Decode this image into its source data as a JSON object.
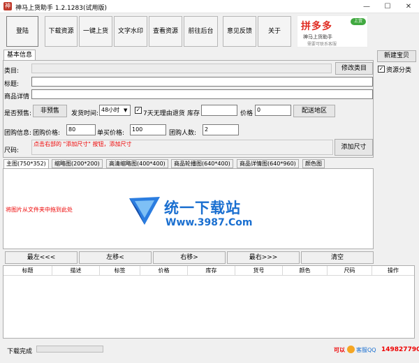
{
  "app": {
    "title": "神马上货助手 1.2.1283(试用版)",
    "icon": "神"
  },
  "window_controls": {
    "minimize": "—",
    "maximize": "☐",
    "close": "✕"
  },
  "toolbar": {
    "buttons": [
      "登陆",
      "下载资源",
      "一键上货",
      "文字水印",
      "查看资源",
      "前往后台",
      "意见反馈",
      "关于"
    ]
  },
  "banner": {
    "brand": "拼多多",
    "badge": "上货",
    "line1": "神马上货助手",
    "line2": "需要可联系客服"
  },
  "right_panel": {
    "new_item": "新建宝贝",
    "resource_category": "资源分类",
    "resource_category_checked": true
  },
  "tab": {
    "basic_info": "基本信息"
  },
  "form": {
    "category_label": "类目:",
    "category_value": "",
    "modify_category": "修改类目",
    "title_label": "标题:",
    "title_value": "",
    "detail_label": "商品详情",
    "detail_value": "",
    "presale_label": "是否预售:",
    "presale_button": "非预售",
    "ship_time_label": "发货时间:",
    "ship_time_value": "48小时",
    "no_reason_return": "7天无理由退货",
    "no_reason_return_checked": true,
    "stock_label": "库存",
    "stock_value": "",
    "price_label": "价格",
    "price_value": "0",
    "delivery_region": "配送地区",
    "group_info_label": "团购信息:",
    "group_price_label": "团购价格:",
    "group_price_value": "80",
    "single_price_label": "单买价格:",
    "single_price_value": "100",
    "group_count_label": "团购人数:",
    "group_count_value": "2",
    "size_label": "尺码:",
    "size_hint": "点击右部的 \"添加尺寸\" 按钮，添加尺寸",
    "add_size": "添加尺寸"
  },
  "image_tabs": [
    "主图(750*352)",
    "缩略图(200*200)",
    "高清缩略图(400*400)",
    "商品轮播图(640*400)",
    "商品详情图(640*960)",
    "颜色图"
  ],
  "drop_hint": "将图片从文件夹中拖到此处",
  "watermark": {
    "title": "统一下载站",
    "url": "Www.3987.Com"
  },
  "nav_buttons": [
    "最左<<<",
    "左移<",
    "右移>",
    "最右>>>",
    "清空"
  ],
  "table": {
    "columns": [
      "标题",
      "描述",
      "标签",
      "价格",
      "库存",
      "货号",
      "颜色",
      "尺码",
      "操作"
    ]
  },
  "status": {
    "text": "下载完成",
    "progress": 0,
    "can_label": "可以",
    "qq_label": "客服QQ",
    "qq_number": "149827790"
  }
}
